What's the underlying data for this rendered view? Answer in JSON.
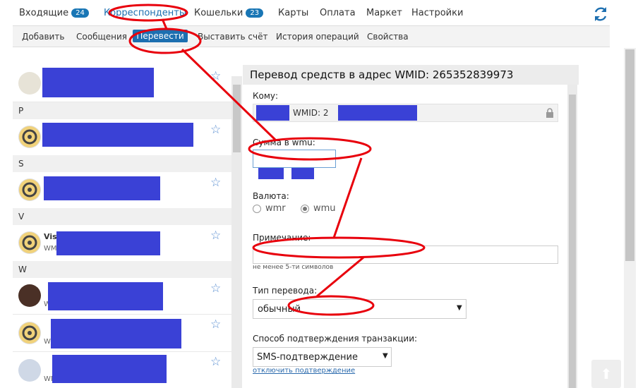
{
  "topnav": {
    "inbox": "Входящие",
    "inbox_count": "24",
    "correspondents": "Корреспонденты",
    "wallets": "Кошельки",
    "wallets_count": "23",
    "cards": "Карты",
    "payment": "Оплата",
    "market": "Маркет",
    "settings": "Настройки"
  },
  "subnav": {
    "add": "Добавить",
    "messages": "Сообщения",
    "transfer": "Перевести",
    "invoice": "Выставить счёт",
    "history": "История операций",
    "properties": "Свойства"
  },
  "contacts": {
    "section_p": "P",
    "section_s": "S",
    "section_v": "V",
    "section_w": "W",
    "vis_name": "Vis",
    "vis_sub": "WM",
    "sub_wm": "WM"
  },
  "form": {
    "title": "Перевод средств в адрес WMID: 265352839973",
    "to_label": "Кому:",
    "to_value": "WMID: 2",
    "amount_label": "Сумма в wmu:",
    "currency_label": "Валюта:",
    "currency_wmr": "wmr",
    "currency_wmu": "wmu",
    "purpose_label": "Примечание:",
    "purpose_hint": "не менее 5-ти символов",
    "type_label": "Тип перевода:",
    "type_value": "обычный",
    "confirm_label": "Способ подтверждения транзакции:",
    "confirm_value": "SMS-подтверждение",
    "confirm_link": "отключить подтверждение"
  },
  "colors": {
    "accent": "#1d6fb0",
    "redaction": "#3a41d6",
    "annotation": "#e8000c"
  }
}
